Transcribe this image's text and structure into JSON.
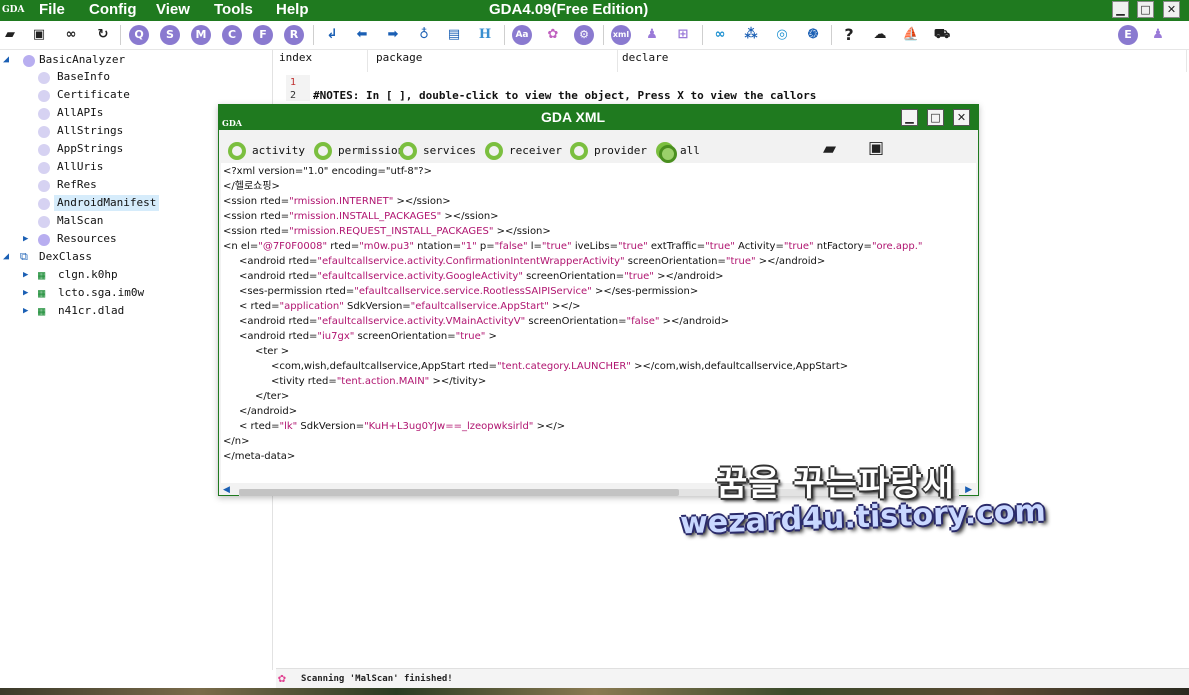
{
  "app": {
    "logo_text": "GDA",
    "title": "GDA4.09(Free Edition)",
    "menu": [
      "File",
      "Config",
      "View",
      "Tools",
      "Help"
    ],
    "window_controls": [
      "minimize",
      "maximize",
      "close"
    ]
  },
  "toolbar": {
    "icons": [
      "open-folder-icon",
      "save-icon",
      "link-icon",
      "refresh-icon",
      "q-icon",
      "s-icon",
      "m-icon",
      "c-icon",
      "f-icon",
      "r-icon",
      "jump-icon",
      "back-arrow-icon",
      "forward-arrow-icon",
      "bulb-icon",
      "document-icon",
      "h-icon",
      "font-icon",
      "colors-icon",
      "gear-icon",
      "xml-icon",
      "android-icon",
      "windows-icon",
      "infinity-icon",
      "graph-icon",
      "target-icon",
      "fingerprint-icon",
      "help-icon",
      "cloud-icon",
      "ship-icon",
      "cart-icon",
      "e-icon",
      "android-alt-icon"
    ],
    "letters": {
      "q": "Q",
      "s": "S",
      "m": "M",
      "c": "C",
      "f": "F",
      "r": "R",
      "h": "H",
      "font": "Aa",
      "xml": "xml",
      "help": "?",
      "e": "E"
    }
  },
  "tree": {
    "root": "BasicAnalyzer",
    "children": [
      "BaseInfo",
      "Certificate",
      "AllAPIs",
      "AllStrings",
      "AppStrings",
      "AllUris",
      "RefRes",
      "AndroidManifest",
      "MalScan",
      "Resources"
    ],
    "selected": "AndroidManifest",
    "dexclass": "DexClass",
    "packages": [
      "clgn.k0hp",
      "lcto.sga.im0w",
      "n41cr.dlad"
    ]
  },
  "columns": {
    "index": "index",
    "package": "package",
    "declare": "declare"
  },
  "code": {
    "line_numbers": [
      "1",
      "2"
    ],
    "note": "#NOTES: In [ ], double-click to view the object, Press X to view the callors"
  },
  "status": {
    "text": "Scanning 'MalScan' finished!"
  },
  "dialog": {
    "logo_text": "GDA",
    "title": "GDA XML",
    "radios": [
      {
        "label": "activity",
        "selected": false
      },
      {
        "label": "permission",
        "selected": false
      },
      {
        "label": "services",
        "selected": false
      },
      {
        "label": "receiver",
        "selected": false
      },
      {
        "label": "provider",
        "selected": false
      },
      {
        "label": "all",
        "selected": true
      }
    ],
    "xml_lines": [
      {
        "indent": 0,
        "parts": [
          [
            "t",
            "<?xml version=\"1.0\" encoding=\"utf-8\"?>"
          ]
        ]
      },
      {
        "indent": 0,
        "parts": [
          [
            "t",
            "</헬로쇼핑>"
          ]
        ]
      },
      {
        "indent": 0,
        "parts": [
          [
            "t",
            "<ssion rted="
          ],
          [
            "v",
            "\"rmission.INTERNET\""
          ],
          [
            "t",
            " ></ssion>"
          ]
        ]
      },
      {
        "indent": 0,
        "parts": [
          [
            "t",
            "<ssion rted="
          ],
          [
            "v",
            "\"rmission.INSTALL_PACKAGES\""
          ],
          [
            "t",
            " ></ssion>"
          ]
        ]
      },
      {
        "indent": 0,
        "parts": [
          [
            "t",
            "<ssion rted="
          ],
          [
            "v",
            "\"rmission.REQUEST_INSTALL_PACKAGES\""
          ],
          [
            "t",
            " ></ssion>"
          ]
        ]
      },
      {
        "indent": 0,
        "parts": [
          [
            "t",
            "<n el="
          ],
          [
            "v",
            "\"@7F0F0008\""
          ],
          [
            "t",
            " rted="
          ],
          [
            "v",
            "\"m0w.pu3\""
          ],
          [
            "t",
            " ntation="
          ],
          [
            "v",
            "\"1\""
          ],
          [
            "t",
            " p="
          ],
          [
            "v",
            "\"false\""
          ],
          [
            "t",
            " l="
          ],
          [
            "v",
            "\"true\""
          ],
          [
            "t",
            " iveLibs="
          ],
          [
            "v",
            "\"true\""
          ],
          [
            "t",
            " extTraffic="
          ],
          [
            "v",
            "\"true\""
          ],
          [
            "t",
            " Activity="
          ],
          [
            "v",
            "\"true\""
          ],
          [
            "t",
            " ntFactory="
          ],
          [
            "v",
            "\"ore.app.\""
          ]
        ]
      },
      {
        "indent": 1,
        "parts": [
          [
            "t",
            "<android rted="
          ],
          [
            "v",
            "\"efaultcallservice.activity.ConfirmationIntentWrapperActivity\""
          ],
          [
            "t",
            " screenOrientation="
          ],
          [
            "v",
            "\"true\""
          ],
          [
            "t",
            " ></android>"
          ]
        ]
      },
      {
        "indent": 1,
        "parts": [
          [
            "t",
            "<android rted="
          ],
          [
            "v",
            "\"efaultcallservice.activity.GoogleActivity\""
          ],
          [
            "t",
            " screenOrientation="
          ],
          [
            "v",
            "\"true\""
          ],
          [
            "t",
            " ></android>"
          ]
        ]
      },
      {
        "indent": 1,
        "parts": [
          [
            "t",
            "<ses-permission rted="
          ],
          [
            "v",
            "\"efaultcallservice.service.RootlessSAIPIService\""
          ],
          [
            "t",
            " ></ses-permission>"
          ]
        ]
      },
      {
        "indent": 1,
        "parts": [
          [
            "t",
            "< rted="
          ],
          [
            "v",
            "\"application\""
          ],
          [
            "t",
            " SdkVersion="
          ],
          [
            "v",
            "\"efaultcallservice.AppStart\""
          ],
          [
            "t",
            " ></>"
          ]
        ]
      },
      {
        "indent": 1,
        "parts": [
          [
            "t",
            "<android rted="
          ],
          [
            "v",
            "\"efaultcallservice.activity.VMainActivityV\""
          ],
          [
            "t",
            " screenOrientation="
          ],
          [
            "v",
            "\"false\""
          ],
          [
            "t",
            " ></android>"
          ]
        ]
      },
      {
        "indent": 1,
        "parts": [
          [
            "t",
            "<android rted="
          ],
          [
            "v",
            "\"iu7gx\""
          ],
          [
            "t",
            " screenOrientation="
          ],
          [
            "v",
            "\"true\""
          ],
          [
            "t",
            " >"
          ]
        ]
      },
      {
        "indent": 2,
        "parts": [
          [
            "t",
            "<ter >"
          ]
        ]
      },
      {
        "indent": 3,
        "parts": [
          [
            "t",
            "<com,wish,defaultcallservice,AppStart rted="
          ],
          [
            "v",
            "\"tent.category.LAUNCHER\""
          ],
          [
            "t",
            " ></com,wish,defaultcallservice,AppStart>"
          ]
        ]
      },
      {
        "indent": 3,
        "parts": [
          [
            "t",
            "<tivity rted="
          ],
          [
            "v",
            "\"tent.action.MAIN\""
          ],
          [
            "t",
            " ></tivity>"
          ]
        ]
      },
      {
        "indent": 2,
        "parts": [
          [
            "t",
            "</ter>"
          ]
        ]
      },
      {
        "indent": 1,
        "parts": [
          [
            "t",
            "</android>"
          ]
        ]
      },
      {
        "indent": 1,
        "parts": [
          [
            "t",
            "< rted="
          ],
          [
            "v",
            "\"lk\""
          ],
          [
            "t",
            " SdkVersion="
          ],
          [
            "v",
            "\"KuH+L3ug0YJw==_lzeopwksirld\""
          ],
          [
            "t",
            " ></>"
          ]
        ]
      },
      {
        "indent": 0,
        "parts": [
          [
            "t",
            "</n>"
          ]
        ]
      },
      {
        "indent": 0,
        "parts": [
          [
            "t",
            "</meta-data>"
          ]
        ]
      }
    ]
  },
  "watermark": {
    "line1": "꿈을 꾸는파랑새",
    "line2": "wezard4u.tistory.com"
  },
  "colors": {
    "titlebar": "#1f7a1f",
    "xml_value": "#b01570",
    "radio": "#7bbf3f",
    "selected_row": "#d6ecfb"
  }
}
